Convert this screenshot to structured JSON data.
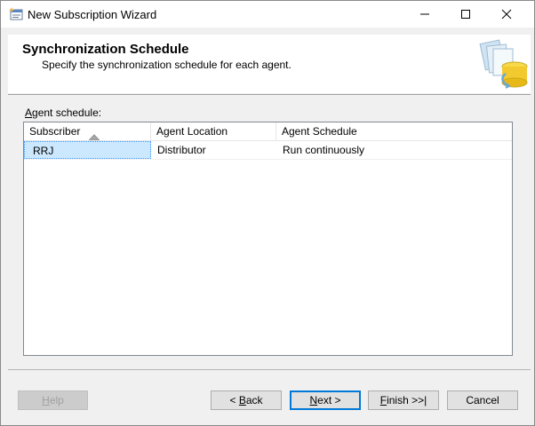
{
  "window": {
    "title": "New Subscription Wizard"
  },
  "header": {
    "title": "Synchronization Schedule",
    "subtitle": "Specify the synchronization schedule for each agent."
  },
  "grid": {
    "label_accel": "A",
    "label_rest": "gent schedule:",
    "columns": [
      "Subscriber",
      "Agent Location",
      "Agent Schedule"
    ],
    "rows": [
      {
        "subscriber": "RRJ",
        "location": "Distributor",
        "schedule": "Run continuously"
      }
    ],
    "sort_column": "Subscriber",
    "sort_direction": "ascending"
  },
  "buttons": {
    "help": {
      "accel": "H",
      "rest": "elp",
      "enabled": false
    },
    "back": {
      "prefix": "< ",
      "accel": "B",
      "rest": "ack"
    },
    "next": {
      "accel": "N",
      "rest": "ext >"
    },
    "finish": {
      "accel": "F",
      "rest": "inish >>|"
    },
    "cancel": {
      "label": "Cancel"
    }
  },
  "colors": {
    "selection": "#cce8ff",
    "default_button_border": "#0078d7"
  }
}
